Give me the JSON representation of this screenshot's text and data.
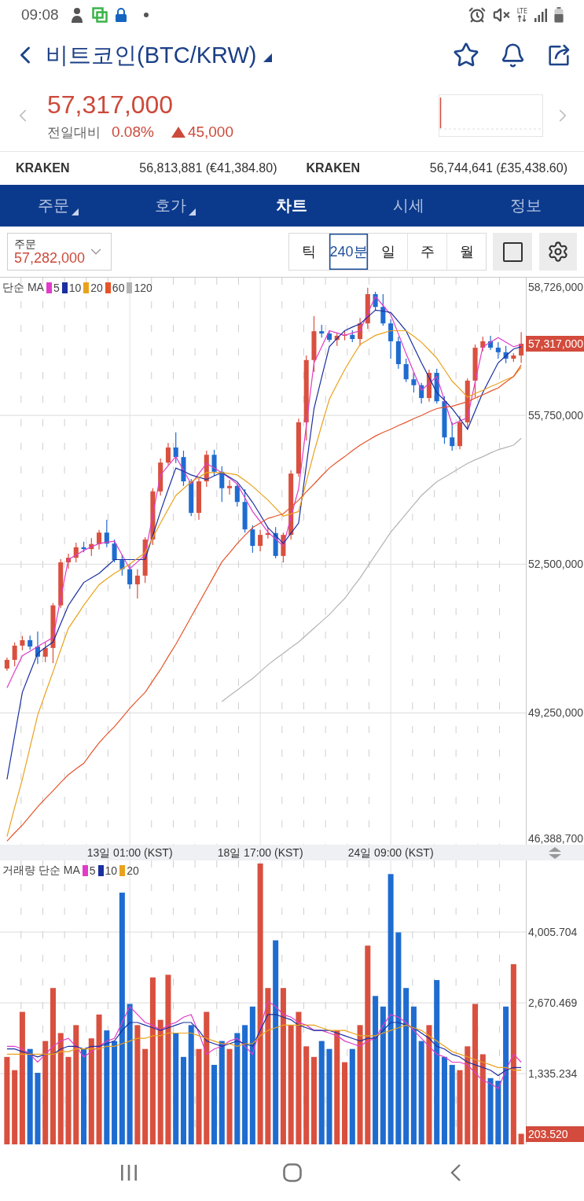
{
  "status_bar": {
    "time": "09:08",
    "network": "LTE"
  },
  "header": {
    "title": "비트코인(BTC/KRW)"
  },
  "quote": {
    "price": "57,317,000",
    "change_label": "전일대비",
    "change_rate": "0.08%",
    "change_amount": "45,000",
    "rising": true
  },
  "exchanges": [
    {
      "name": "KRAKEN",
      "value": "56,813,881 (€41,384.80)"
    },
    {
      "name": "KRAKEN",
      "value": "56,744,641 (£35,438.60)"
    }
  ],
  "tabs": [
    {
      "label": "주문",
      "has_menu": true,
      "selected": false
    },
    {
      "label": "호가",
      "has_menu": true,
      "selected": false
    },
    {
      "label": "차트",
      "has_menu": false,
      "selected": true
    },
    {
      "label": "시세",
      "has_menu": false,
      "selected": false
    },
    {
      "label": "정보",
      "has_menu": false,
      "selected": false
    }
  ],
  "order_select": {
    "label": "주문",
    "value": "57,282,000"
  },
  "periods": [
    {
      "label": "틱",
      "selected": false
    },
    {
      "label": "240분",
      "selected": true
    },
    {
      "label": "일",
      "selected": false
    },
    {
      "label": "주",
      "selected": false
    },
    {
      "label": "월",
      "selected": false
    }
  ],
  "price_chart": {
    "legend_title": "단순 MA",
    "current_price": "57,317,000",
    "chart_data": {
      "type": "candlestick",
      "grid": true,
      "legend": "upper left",
      "categories": [
        null,
        null,
        null,
        null,
        null,
        null,
        null,
        null,
        null,
        null,
        null,
        null,
        null,
        null,
        null,
        null,
        "13일 01:00 (KST)",
        null,
        null,
        null,
        null,
        null,
        null,
        null,
        null,
        null,
        null,
        null,
        null,
        null,
        null,
        null,
        null,
        "18일 17:00 (KST)",
        null,
        null,
        null,
        null,
        null,
        null,
        null,
        null,
        null,
        null,
        null,
        null,
        null,
        null,
        null,
        null,
        "24일 09:00 (KST)",
        null,
        null,
        null,
        null,
        null,
        null,
        null,
        null,
        null,
        null,
        null,
        null,
        null,
        null,
        null,
        null,
        null
      ],
      "ylim": [
        46388700,
        58726000
      ],
      "yticks": [
        {
          "value": 58726000,
          "label": "58,726,000"
        },
        {
          "value": 55750000,
          "label": "55,750,000"
        },
        {
          "value": 52500000,
          "label": "52,500,000"
        },
        {
          "value": 49250000,
          "label": "49,250,000"
        },
        {
          "value": 46388700,
          "label": "46,388,700"
        }
      ],
      "ohlc": [
        [
          50220000,
          50460000,
          50170000,
          50410000
        ],
        [
          50410000,
          50790000,
          50270000,
          50720000
        ],
        [
          50720000,
          50930000,
          50620000,
          50840000
        ],
        [
          50840000,
          50940000,
          50630000,
          50700000
        ],
        [
          50700000,
          51030000,
          50320000,
          50480000
        ],
        [
          50480000,
          50800000,
          50360000,
          50670000
        ],
        [
          50670000,
          51650000,
          50340000,
          51600000
        ],
        [
          51600000,
          52610000,
          51540000,
          52540000
        ],
        [
          52540000,
          52730000,
          52400000,
          52640000
        ],
        [
          52640000,
          52970000,
          52540000,
          52870000
        ],
        [
          52870000,
          52990000,
          52760000,
          52830000
        ],
        [
          52830000,
          53070000,
          52680000,
          52940000
        ],
        [
          52940000,
          53250000,
          52820000,
          53190000
        ],
        [
          53190000,
          53470000,
          52870000,
          52950000
        ],
        [
          52950000,
          53040000,
          52540000,
          52590000
        ],
        [
          52590000,
          52700000,
          52250000,
          52390000
        ],
        [
          52390000,
          52510000,
          51960000,
          52060000
        ],
        [
          52060000,
          52390000,
          51750000,
          52250000
        ],
        [
          52250000,
          53090000,
          52090000,
          53040000
        ],
        [
          53040000,
          54160000,
          52920000,
          54090000
        ],
        [
          54090000,
          54810000,
          54000000,
          54720000
        ],
        [
          54720000,
          55150000,
          54670000,
          55050000
        ],
        [
          55050000,
          55380000,
          54710000,
          54840000
        ],
        [
          54840000,
          54980000,
          54210000,
          54310000
        ],
        [
          54310000,
          54360000,
          53550000,
          53620000
        ],
        [
          53620000,
          54380000,
          53470000,
          54310000
        ],
        [
          54310000,
          54980000,
          54190000,
          54890000
        ],
        [
          54890000,
          55000000,
          54430000,
          54520000
        ],
        [
          54520000,
          54640000,
          53860000,
          54160000
        ],
        [
          54160000,
          54340000,
          54020000,
          54210000
        ],
        [
          54210000,
          54260000,
          53760000,
          53860000
        ],
        [
          53860000,
          54140000,
          53190000,
          53260000
        ],
        [
          53260000,
          53350000,
          52750000,
          52900000
        ],
        [
          52900000,
          53250000,
          52780000,
          53140000
        ],
        [
          53140000,
          53300000,
          53060000,
          53180000
        ],
        [
          53180000,
          53310000,
          52630000,
          52680000
        ],
        [
          52680000,
          53190000,
          52540000,
          53140000
        ],
        [
          53140000,
          54550000,
          53040000,
          54480000
        ],
        [
          54480000,
          55680000,
          54410000,
          55600000
        ],
        [
          55600000,
          57060000,
          55200000,
          56960000
        ],
        [
          56960000,
          57920000,
          56700000,
          57590000
        ],
        [
          57590000,
          57730000,
          57450000,
          57540000
        ],
        [
          57540000,
          57590000,
          57350000,
          57400000
        ],
        [
          57400000,
          57560000,
          57270000,
          57490000
        ],
        [
          57490000,
          57590000,
          57390000,
          57510000
        ],
        [
          57510000,
          57610000,
          57350000,
          57420000
        ],
        [
          57420000,
          57880000,
          57270000,
          57760000
        ],
        [
          57760000,
          58540000,
          57640000,
          58400000
        ],
        [
          58400000,
          58450000,
          58040000,
          58120000
        ],
        [
          58120000,
          58400000,
          57710000,
          57760000
        ],
        [
          57760000,
          57850000,
          56990000,
          57370000
        ],
        [
          57370000,
          57470000,
          56770000,
          56870000
        ],
        [
          56870000,
          56990000,
          56480000,
          56540000
        ],
        [
          56540000,
          56680000,
          56250000,
          56410000
        ],
        [
          56410000,
          56460000,
          56010000,
          56130000
        ],
        [
          56130000,
          56750000,
          56050000,
          56680000
        ],
        [
          56680000,
          56770000,
          56010000,
          56060000
        ],
        [
          56060000,
          56170000,
          55130000,
          55270000
        ],
        [
          55270000,
          55600000,
          54980000,
          55080000
        ],
        [
          55080000,
          55740000,
          55010000,
          55600000
        ],
        [
          55600000,
          56560000,
          55440000,
          56510000
        ],
        [
          56510000,
          57300000,
          56150000,
          57230000
        ],
        [
          57230000,
          57470000,
          57150000,
          57370000
        ],
        [
          57370000,
          57490000,
          57180000,
          57230000
        ],
        [
          57230000,
          57350000,
          56990000,
          57130000
        ],
        [
          57130000,
          57270000,
          56890000,
          56990000
        ],
        [
          56990000,
          57110000,
          56920000,
          57060000
        ],
        [
          57060000,
          57570000,
          56900000,
          57317000
        ]
      ],
      "series": [
        {
          "name": "5",
          "type": "line",
          "color": "#e03cc8",
          "values": [
            49800000,
            50150000,
            50500000,
            50600000,
            50700000,
            50800000,
            50900000,
            51750000,
            52600000,
            52700000,
            52800000,
            52880000,
            52950000,
            52980000,
            53000000,
            52700000,
            52400000,
            52550000,
            52700000,
            53580000,
            54450000,
            54650000,
            54850000,
            54550000,
            54250000,
            54480000,
            54700000,
            54600000,
            54500000,
            54380000,
            54250000,
            53950000,
            53650000,
            53430000,
            53200000,
            53050000,
            52900000,
            53530000,
            54150000,
            55530000,
            56900000,
            57250000,
            57600000,
            57550000,
            57500000,
            57550000,
            57600000,
            57980000,
            58350000,
            58150000,
            57950000,
            57530000,
            57100000,
            56700000,
            56300000,
            56450000,
            56600000,
            56080000,
            55550000,
            55630000,
            55700000,
            56480000,
            57250000,
            57350000,
            57450000,
            57350000,
            57250000,
            57300000
          ]
        },
        {
          "name": "10",
          "type": "line",
          "color": "#1a2fa0",
          "values": [
            47800000,
            48750000,
            49700000,
            50130000,
            50550000,
            50680000,
            50800000,
            51200000,
            51600000,
            51850000,
            52100000,
            52200000,
            52300000,
            52450000,
            52600000,
            52600000,
            52600000,
            52600000,
            52600000,
            53130000,
            53650000,
            54130000,
            54600000,
            54530000,
            54450000,
            54400000,
            54350000,
            54430000,
            54500000,
            54400000,
            54300000,
            54080000,
            53850000,
            53580000,
            53300000,
            53130000,
            52950000,
            53180000,
            53400000,
            54650000,
            55900000,
            56580000,
            57250000,
            57430000,
            57600000,
            57680000,
            57750000,
            57900000,
            58050000,
            58030000,
            58000000,
            57800000,
            57600000,
            57250000,
            56900000,
            56580000,
            56250000,
            56080000,
            55900000,
            55680000,
            55450000,
            55850000,
            56250000,
            56580000,
            56900000,
            57050000,
            57200000,
            57250000
          ]
        },
        {
          "name": "20",
          "type": "line",
          "color": "#e9a21c",
          "values": [
            46550000,
            47180000,
            47800000,
            48500000,
            49200000,
            49680000,
            50150000,
            50630000,
            51100000,
            51350000,
            51600000,
            51830000,
            52050000,
            52180000,
            52300000,
            52400000,
            52500000,
            52630000,
            52750000,
            53080000,
            53400000,
            53700000,
            54000000,
            54150000,
            54300000,
            54400000,
            54500000,
            54500000,
            54500000,
            54480000,
            54450000,
            54330000,
            54200000,
            54050000,
            53900000,
            53730000,
            53550000,
            53600000,
            53650000,
            54300000,
            54950000,
            55530000,
            56100000,
            56430000,
            56750000,
            57030000,
            57300000,
            57400000,
            57500000,
            57550000,
            57600000,
            57600000,
            57600000,
            57480000,
            57350000,
            57180000,
            57000000,
            56750000,
            56500000,
            56330000,
            56150000,
            56230000,
            56300000,
            56380000,
            56450000,
            56530000,
            56600000,
            56800000
          ]
        },
        {
          "name": "60",
          "type": "line",
          "color": "#e6542a",
          "values": [
            46450000,
            46630000,
            46800000,
            47000000,
            47200000,
            47380000,
            47550000,
            47730000,
            47900000,
            48030000,
            48150000,
            48380000,
            48600000,
            48780000,
            48950000,
            49150000,
            49350000,
            49530000,
            49700000,
            49950000,
            50200000,
            50480000,
            50750000,
            51050000,
            51350000,
            51650000,
            51950000,
            52250000,
            52550000,
            52750000,
            52950000,
            53130000,
            53300000,
            53400000,
            53500000,
            53550000,
            53600000,
            53750000,
            53900000,
            54080000,
            54250000,
            54430000,
            54600000,
            54730000,
            54850000,
            54980000,
            55100000,
            55200000,
            55300000,
            55380000,
            55450000,
            55530000,
            55600000,
            55680000,
            55750000,
            55830000,
            55900000,
            55930000,
            55950000,
            56000000,
            56050000,
            56130000,
            56200000,
            56280000,
            56350000,
            56480000,
            56600000,
            56850000
          ]
        },
        {
          "name": "120",
          "type": "line",
          "color": "#b4b4b4",
          "values": [
            null,
            null,
            null,
            null,
            null,
            null,
            null,
            null,
            null,
            null,
            null,
            null,
            null,
            null,
            null,
            null,
            null,
            null,
            null,
            null,
            null,
            null,
            null,
            null,
            null,
            null,
            null,
            null,
            49500000,
            49630000,
            49750000,
            49880000,
            50000000,
            50150000,
            50300000,
            50430000,
            50550000,
            50680000,
            50800000,
            50950000,
            51100000,
            51250000,
            51400000,
            51580000,
            51750000,
            51980000,
            52200000,
            52450000,
            52700000,
            52950000,
            53200000,
            53400000,
            53600000,
            53800000,
            54000000,
            54150000,
            54300000,
            54400000,
            54500000,
            54600000,
            54700000,
            54780000,
            54850000,
            54930000,
            55000000,
            55050000,
            55100000,
            55250000
          ]
        }
      ]
    }
  },
  "volume_chart": {
    "legend_title": "거래량 단순 MA",
    "current_volume": "203.520",
    "chart_data": {
      "type": "bar",
      "grid": true,
      "legend": "upper left",
      "categories": [
        null,
        null,
        null,
        null,
        null,
        null,
        null,
        null,
        null,
        null,
        null,
        null,
        null,
        null,
        null,
        null,
        null,
        null,
        null,
        null,
        null,
        null,
        null,
        null,
        null,
        null,
        null,
        null,
        null,
        null,
        null,
        null,
        null,
        null,
        null,
        null,
        null,
        null,
        null,
        null,
        null,
        null,
        null,
        null,
        null,
        null,
        null,
        null,
        null,
        null,
        null,
        null,
        null,
        null,
        null,
        null,
        null,
        null,
        null,
        null,
        null,
        null,
        null,
        null,
        null,
        null,
        null,
        null
      ],
      "ylim": [
        0,
        5357
      ],
      "yticks": [
        {
          "value": 4005.704,
          "label": "4,005.704"
        },
        {
          "value": 2670.469,
          "label": "2,670.469"
        },
        {
          "value": 1335.234,
          "label": "1,335.234"
        }
      ],
      "series": [
        {
          "colors": [
            "#d9503f",
            "#d9503f",
            "#d9503f",
            "#1f6cd0",
            "#1f6cd0",
            "#d9503f",
            "#d9503f",
            "#d9503f",
            "#d9503f",
            "#d9503f",
            "#1f6cd0",
            "#d9503f",
            "#d9503f",
            "#1f6cd0",
            "#1f6cd0",
            "#1f6cd0",
            "#1f6cd0",
            "#d9503f",
            "#d9503f",
            "#d9503f",
            "#d9503f",
            "#d9503f",
            "#1f6cd0",
            "#1f6cd0",
            "#1f6cd0",
            "#d9503f",
            "#d9503f",
            "#1f6cd0",
            "#1f6cd0",
            "#d9503f",
            "#1f6cd0",
            "#1f6cd0",
            "#1f6cd0",
            "#d9503f",
            "#d9503f",
            "#1f6cd0",
            "#d9503f",
            "#d9503f",
            "#d9503f",
            "#d9503f",
            "#d9503f",
            "#1f6cd0",
            "#1f6cd0",
            "#d9503f",
            "#d9503f",
            "#1f6cd0",
            "#d9503f",
            "#d9503f",
            "#1f6cd0",
            "#1f6cd0",
            "#1f6cd0",
            "#1f6cd0",
            "#1f6cd0",
            "#1f6cd0",
            "#1f6cd0",
            "#d9503f",
            "#1f6cd0",
            "#1f6cd0",
            "#1f6cd0",
            "#d9503f",
            "#d9503f",
            "#d9503f",
            "#d9503f",
            "#1f6cd0",
            "#1f6cd0",
            "#1f6cd0",
            "#d9503f",
            "#d9503f"
          ],
          "values": [
            1650,
            1400,
            2500,
            1800,
            1350,
            1950,
            2950,
            2100,
            1650,
            2250,
            1800,
            2000,
            2450,
            2150,
            1950,
            4750,
            2650,
            2250,
            1800,
            3150,
            2350,
            3200,
            2100,
            1650,
            2250,
            1800,
            2500,
            1500,
            1950,
            1800,
            2100,
            2250,
            2600,
            5300,
            2950,
            3850,
            2950,
            2250,
            2500,
            1850,
            1650,
            1950,
            1800,
            2150,
            1550,
            1800,
            2250,
            3750,
            2800,
            2600,
            5100,
            4000,
            2950,
            2600,
            1950,
            2250,
            3100,
            1650,
            1500,
            1400,
            1850,
            2650,
            1700,
            1250,
            1200,
            2600,
            3400,
            200
          ]
        },
        {
          "type": "line",
          "name": "5",
          "color": "#e03cc8",
          "values": [
            1850,
            1850,
            1800,
            1700,
            1550,
            1700,
            1850,
            1950,
            2000,
            1850,
            1650,
            1750,
            1850,
            1950,
            2000,
            2300,
            2600,
            2450,
            2300,
            2250,
            2150,
            2250,
            2300,
            2400,
            2450,
            2100,
            1700,
            1800,
            1850,
            1950,
            2000,
            1850,
            1700,
            2200,
            2700,
            2600,
            2450,
            2400,
            2300,
            2250,
            2150,
            2150,
            2100,
            2050,
            1950,
            1900,
            1850,
            1950,
            2000,
            2250,
            2450,
            2400,
            2300,
            2150,
            2000,
            1850,
            1700,
            1650,
            1550,
            1550,
            1500,
            1350,
            1200,
            1150,
            1050,
            1400,
            1700,
            1550
          ]
        },
        {
          "type": "line",
          "name": "10",
          "color": "#1a2fa0",
          "values": [
            1800,
            1800,
            1750,
            1700,
            1650,
            1700,
            1700,
            1800,
            1850,
            1850,
            1800,
            1850,
            1850,
            1900,
            1950,
            2150,
            2300,
            2300,
            2250,
            2200,
            2150,
            2200,
            2250,
            2300,
            2300,
            2150,
            1950,
            1900,
            1850,
            1900,
            1950,
            1900,
            1850,
            2150,
            2450,
            2450,
            2400,
            2350,
            2250,
            2200,
            2150,
            2150,
            2150,
            2100,
            2050,
            2000,
            1950,
            2000,
            2000,
            2150,
            2300,
            2300,
            2250,
            2200,
            2100,
            2000,
            1850,
            1800,
            1700,
            1650,
            1550,
            1500,
            1450,
            1400,
            1300,
            1400,
            1450,
            1450
          ]
        },
        {
          "type": "line",
          "name": "20",
          "color": "#e9a21c",
          "values": [
            1700,
            1700,
            1700,
            1700,
            1700,
            1700,
            1700,
            1750,
            1750,
            1800,
            1800,
            1800,
            1800,
            1850,
            1850,
            1900,
            1950,
            2000,
            2000,
            2050,
            2050,
            2100,
            2100,
            2100,
            2100,
            2050,
            2000,
            1950,
            1900,
            1900,
            1850,
            1900,
            1900,
            2050,
            2150,
            2200,
            2250,
            2250,
            2250,
            2250,
            2250,
            2200,
            2150,
            2150,
            2150,
            2100,
            2050,
            2050,
            2050,
            2100,
            2150,
            2200,
            2250,
            2200,
            2150,
            2050,
            1950,
            1850,
            1750,
            1700,
            1650,
            1600,
            1550,
            1500,
            1450,
            1450,
            1400,
            1400
          ]
        }
      ]
    }
  }
}
